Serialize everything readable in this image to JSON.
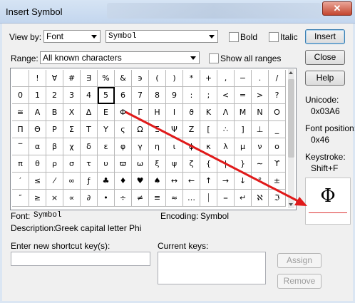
{
  "dialog": {
    "title": "Insert Symbol",
    "close_glyph": "✕",
    "accent_color": "#3c7fb1",
    "arrow_color": "#e01a1a"
  },
  "view_by": {
    "label": "View by:",
    "mode_value": "Font",
    "font_value": "Symbol"
  },
  "checkboxes": {
    "bold": "Bold",
    "italic": "Italic",
    "show_all_ranges": "Show all ranges"
  },
  "range": {
    "label": "Range:",
    "value": "All known characters"
  },
  "buttons": {
    "insert": "Insert",
    "close": "Close",
    "help": "Help",
    "assign": "Assign",
    "remove": "Remove"
  },
  "info": {
    "unicode_label": "Unicode:",
    "unicode_value": "0x03A6",
    "font_position_label": "Font position:",
    "font_position_value": "0x46",
    "keystroke_label": "Keystroke:",
    "keystroke_value": "Shift+F"
  },
  "preview_glyph": "Φ",
  "selected_cell": 21,
  "grid": [
    " ",
    "!",
    "∀",
    "#",
    "∃",
    "%",
    "&",
    "϶",
    "(",
    ")",
    "*",
    "+",
    ",",
    "−",
    ".",
    "/",
    "0",
    "1",
    "2",
    "3",
    "4",
    "5",
    "6",
    "7",
    "8",
    "9",
    ":",
    ";",
    "<",
    "=",
    ">",
    "?",
    "≅",
    "Α",
    "Β",
    "Χ",
    "Δ",
    "Ε",
    "Φ",
    "Γ",
    "Η",
    "Ι",
    "ϑ",
    "Κ",
    "Λ",
    "Μ",
    "Ν",
    "Ο",
    "Π",
    "Θ",
    "Ρ",
    "Σ",
    "Τ",
    "Υ",
    "ς",
    "Ω",
    "Ξ",
    "Ψ",
    "Ζ",
    "[",
    "∴",
    "]",
    "⊥",
    "_",
    "‾",
    "α",
    "β",
    "χ",
    "δ",
    "ε",
    "φ",
    "γ",
    "η",
    "ι",
    "ϕ",
    "κ",
    "λ",
    "μ",
    "ν",
    "ο",
    "π",
    "θ",
    "ρ",
    "σ",
    "τ",
    "υ",
    "ϖ",
    "ω",
    "ξ",
    "ψ",
    "ζ",
    "{",
    "|",
    "}",
    "∼",
    "ϒ",
    "′",
    "≤",
    "⁄",
    "∞",
    "ƒ",
    "♣",
    "♦",
    "♥",
    "♠",
    "↔",
    "←",
    "↑",
    "→",
    "↓",
    "°",
    "±",
    "″",
    "≥",
    "×",
    "∝",
    "∂",
    "•",
    "÷",
    "≠",
    "≡",
    "≈",
    "…",
    "⏐",
    "⎯",
    "↵",
    "ℵ",
    "ℑ"
  ],
  "footer": {
    "font_label": "Font:",
    "font_value": "Symbol",
    "encoding_label": "Encoding:",
    "encoding_value": "Symbol",
    "description_label": "Description:",
    "description_value": "Greek capital letter Phi",
    "shortcut_label": "Enter new shortcut key(s):",
    "current_keys_label": "Current keys:"
  }
}
